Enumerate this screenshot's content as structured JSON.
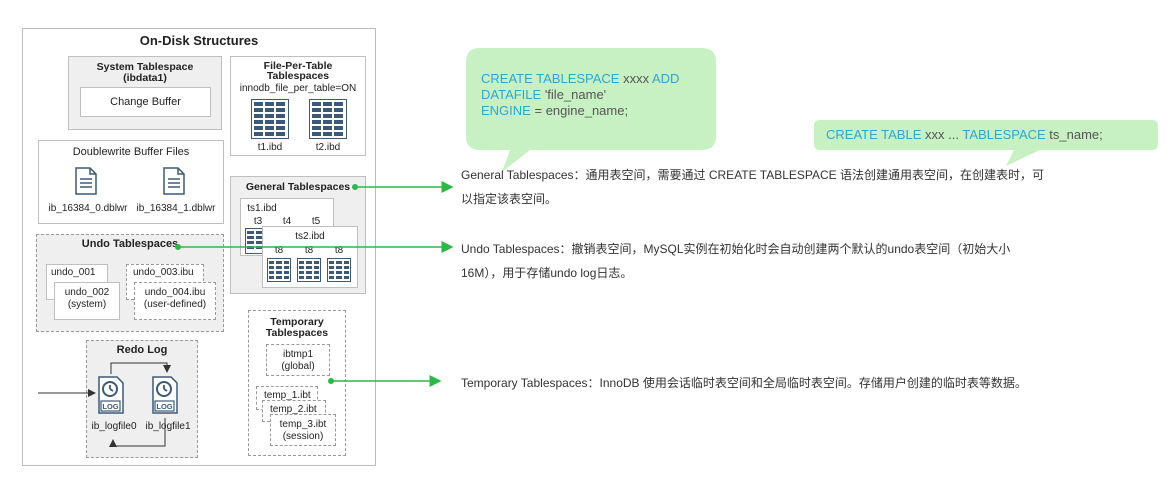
{
  "diagram": {
    "title": "On-Disk Structures",
    "system_tablespace": {
      "title": "System Tablespace",
      "subtitle": "(ibdata1)",
      "change_buffer": "Change Buffer"
    },
    "file_per_table": {
      "title_line1": "File-Per-Table",
      "title_line2": "Tablespaces",
      "setting": "innodb_file_per_table=ON",
      "files": [
        "t1.ibd",
        "t2.ibd"
      ]
    },
    "doublewrite": {
      "title": "Doublewrite Buffer Files",
      "files": [
        "ib_16384_0.dblwr",
        "ib_16384_1.dblwr"
      ]
    },
    "general_tablespaces": {
      "title": "General Tablespaces",
      "ts1": "ts1.ibd",
      "ts1_tables": [
        "t3",
        "t4",
        "t5"
      ],
      "ts2": "ts2.ibd",
      "ts2_tables": [
        "t8",
        "t8",
        "t8"
      ]
    },
    "undo_tablespaces": {
      "title": "Undo Tablespaces",
      "undo_001": "undo_001",
      "undo_002": "undo_002",
      "undo_002_note": "(system)",
      "undo_003": "undo_003.ibu",
      "undo_004": "undo_004.ibu",
      "undo_004_note": "(user-defined)"
    },
    "redo_log": {
      "title": "Redo Log",
      "icon_text": "LOG",
      "files": [
        "ib_logfile0",
        "ib_logfile1"
      ]
    },
    "temporary": {
      "title_line1": "Temporary",
      "title_line2": "Tablespaces",
      "ibtmp": "ibtmp1",
      "ibtmp_note": "(global)",
      "temp1": "temp_1.ibt",
      "temp2": "temp_2.ibt",
      "temp3": "temp_3.ibt",
      "temp3_note": "(session)"
    }
  },
  "bubbles": {
    "create_tablespace": {
      "line1_kw": "CREATE TABLESPACE",
      "line1_val": "xxxx",
      "line1_kw2": "ADD",
      "line2_kw": "DATAFILE",
      "line2_val": "'file_name'",
      "line3_kw": "ENGINE",
      "line3_eq": "=",
      "line3_val": "engine_name;"
    },
    "create_table": {
      "kw1": "CREATE  TABLE",
      "val1": "xxx ...",
      "kw2": "TABLESPACE",
      "val2": "ts_name;"
    }
  },
  "descriptions": {
    "general_1": "General Tablespaces：通用表空间，需要通过 CREATE TABLESPACE 语法创建通用表空间，在创建表时，可",
    "general_2": "以指定该表空间。",
    "undo_1": "Undo Tablespaces：撤销表空间，MySQL实例在初始化时会自动创建两个默认的undo表空间（初始大小",
    "undo_2": "16M），用于存储undo log日志。",
    "temporary": "Temporary Tablespaces：InnoDB 使用会话临时表空间和全局临时表空间。存储用户创建的临时表等数据。"
  },
  "colors": {
    "bubble": "#c8f1c3",
    "sql_keyword": "#2aa7d6",
    "connector": "#2db84a",
    "table_icon": "#3c5a78"
  }
}
